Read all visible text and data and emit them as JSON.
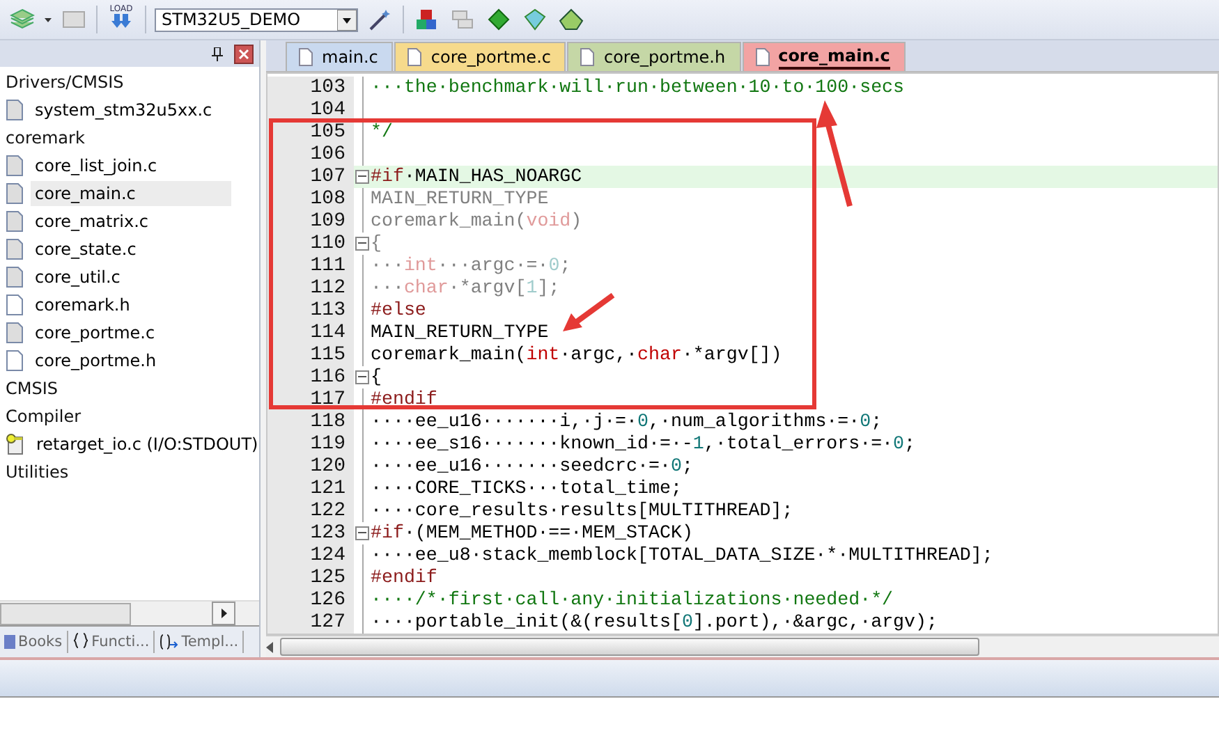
{
  "toolbar": {
    "load_label": "LOAD",
    "target": "STM32U5_DEMO"
  },
  "project_panel": {
    "tree": [
      {
        "label": "Drivers/CMSIS",
        "kind": "group",
        "children": [
          {
            "label": "system_stm32u5xx.c",
            "kind": "source",
            "selected": false
          }
        ]
      },
      {
        "label": "coremark",
        "kind": "group",
        "children": [
          {
            "label": "core_list_join.c",
            "kind": "source",
            "selected": false
          },
          {
            "label": "core_main.c",
            "kind": "source",
            "selected": true
          },
          {
            "label": "core_matrix.c",
            "kind": "source",
            "selected": false
          },
          {
            "label": "core_state.c",
            "kind": "source",
            "selected": false
          },
          {
            "label": "core_util.c",
            "kind": "source",
            "selected": false
          },
          {
            "label": "coremark.h",
            "kind": "header",
            "selected": false
          },
          {
            "label": "core_portme.c",
            "kind": "source",
            "selected": false
          },
          {
            "label": "core_portme.h",
            "kind": "header",
            "selected": false
          }
        ]
      },
      {
        "label": "CMSIS",
        "kind": "group"
      },
      {
        "label": "Compiler",
        "kind": "group",
        "children": [
          {
            "label": "retarget_io.c (I/O:STDOUT)",
            "kind": "config",
            "selected": false
          }
        ]
      },
      {
        "label": "Utilities",
        "kind": "group"
      }
    ],
    "bottom_tabs": [
      {
        "label": "Books",
        "kind": "books"
      },
      {
        "label": "Functi...",
        "kind": "functions"
      },
      {
        "label": "Templ...",
        "kind": "templates"
      }
    ]
  },
  "editor": {
    "tabs": [
      {
        "label": "main.c",
        "color": "#c9d9ef",
        "selected": false
      },
      {
        "label": "core_portme.c",
        "color": "#f6da8c",
        "selected": false
      },
      {
        "label": "core_portme.h",
        "color": "#c5d7a6",
        "selected": false
      },
      {
        "label": "core_main.c",
        "color": "#f2a3a3",
        "selected": true
      }
    ],
    "lines": [
      {
        "number": "103",
        "fold": false,
        "highlighted": false,
        "tokens": [
          {
            "text": "···the·benchmark·will·run·between·10·to·100·secs",
            "kind": "comment"
          }
        ]
      },
      {
        "number": "104",
        "fold": false,
        "highlighted": false
      },
      {
        "number": "105",
        "fold": false,
        "highlighted": false,
        "tokens": [
          {
            "text": "*/",
            "kind": "comment"
          }
        ]
      },
      {
        "number": "106",
        "fold": false,
        "highlighted": false
      },
      {
        "number": "107",
        "fold": true,
        "highlighted": true,
        "tokens": [
          {
            "text": "#if",
            "kind": "preproc"
          },
          {
            "text": "·MAIN_HAS_NOARGC",
            "kind": "plain"
          }
        ]
      },
      {
        "number": "108",
        "fold": false,
        "highlighted": false,
        "tokens": [
          {
            "text": "MAIN_RETURN_TYPE",
            "kind": "inactive"
          }
        ]
      },
      {
        "number": "109",
        "fold": false,
        "highlighted": false,
        "tokens": [
          {
            "text": "coremark_main(",
            "kind": "inactive"
          },
          {
            "text": "void",
            "kind": "inactive_keyword"
          },
          {
            "text": ")",
            "kind": "inactive"
          }
        ]
      },
      {
        "number": "110",
        "fold": true,
        "highlighted": false,
        "tokens": [
          {
            "text": "{",
            "kind": "inactive"
          }
        ]
      },
      {
        "number": "111",
        "fold": false,
        "highlighted": false,
        "tokens": [
          {
            "text": "···",
            "kind": "inactive"
          },
          {
            "text": "int",
            "kind": "inactive_keyword"
          },
          {
            "text": "···argc·=·",
            "kind": "inactive"
          },
          {
            "text": "0",
            "kind": "inactive_number"
          },
          {
            "text": ";",
            "kind": "inactive"
          }
        ]
      },
      {
        "number": "112",
        "fold": false,
        "highlighted": false,
        "tokens": [
          {
            "text": "···",
            "kind": "inactive"
          },
          {
            "text": "char",
            "kind": "inactive_keyword"
          },
          {
            "text": "·*argv[",
            "kind": "inactive"
          },
          {
            "text": "1",
            "kind": "inactive_number"
          },
          {
            "text": "];",
            "kind": "inactive"
          }
        ]
      },
      {
        "number": "113",
        "fold": false,
        "highlighted": false,
        "tokens": [
          {
            "text": "#else",
            "kind": "preproc"
          }
        ]
      },
      {
        "number": "114",
        "fold": false,
        "highlighted": false,
        "tokens": [
          {
            "text": "MAIN_RETURN_TYPE",
            "kind": "plain"
          }
        ]
      },
      {
        "number": "115",
        "fold": false,
        "highlighted": false,
        "tokens": [
          {
            "text": "coremark_main(",
            "kind": "plain"
          },
          {
            "text": "int",
            "kind": "keyword"
          },
          {
            "text": "·argc,·",
            "kind": "plain"
          },
          {
            "text": "char",
            "kind": "keyword"
          },
          {
            "text": "·*argv[])",
            "kind": "plain"
          }
        ]
      },
      {
        "number": "116",
        "fold": true,
        "highlighted": false,
        "tokens": [
          {
            "text": "{",
            "kind": "plain"
          }
        ]
      },
      {
        "number": "117",
        "fold": false,
        "highlighted": false,
        "tokens": [
          {
            "text": "#endif",
            "kind": "preproc"
          }
        ]
      },
      {
        "number": "118",
        "fold": false,
        "highlighted": false,
        "tokens": [
          {
            "text": "····ee_u16·······i,·j·=·",
            "kind": "plain"
          },
          {
            "text": "0",
            "kind": "number"
          },
          {
            "text": ",·num_algorithms·=·",
            "kind": "plain"
          },
          {
            "text": "0",
            "kind": "number"
          },
          {
            "text": ";",
            "kind": "plain"
          }
        ]
      },
      {
        "number": "119",
        "fold": false,
        "highlighted": false,
        "tokens": [
          {
            "text": "····ee_s16·······known_id·=·-",
            "kind": "plain"
          },
          {
            "text": "1",
            "kind": "number"
          },
          {
            "text": ",·total_errors·=·",
            "kind": "plain"
          },
          {
            "text": "0",
            "kind": "number"
          },
          {
            "text": ";",
            "kind": "plain"
          }
        ]
      },
      {
        "number": "120",
        "fold": false,
        "highlighted": false,
        "tokens": [
          {
            "text": "····ee_u16·······seedcrc·=·",
            "kind": "plain"
          },
          {
            "text": "0",
            "kind": "number"
          },
          {
            "text": ";",
            "kind": "plain"
          }
        ]
      },
      {
        "number": "121",
        "fold": false,
        "highlighted": false,
        "tokens": [
          {
            "text": "····CORE_TICKS···total_time;",
            "kind": "plain"
          }
        ]
      },
      {
        "number": "122",
        "fold": false,
        "highlighted": false,
        "tokens": [
          {
            "text": "····core_results·results[MULTITHREAD];",
            "kind": "plain"
          }
        ]
      },
      {
        "number": "123",
        "fold": true,
        "highlighted": false,
        "tokens": [
          {
            "text": "#if",
            "kind": "preproc"
          },
          {
            "text": "·(MEM_METHOD·==·MEM_STACK)",
            "kind": "plain"
          }
        ]
      },
      {
        "number": "124",
        "fold": false,
        "highlighted": false,
        "tokens": [
          {
            "text": "····ee_u8·stack_memblock[TOTAL_DATA_SIZE·*·MULTITHREAD];",
            "kind": "plain"
          }
        ]
      },
      {
        "number": "125",
        "fold": false,
        "highlighted": false,
        "tokens": [
          {
            "text": "#endif",
            "kind": "preproc"
          }
        ]
      },
      {
        "number": "126",
        "fold": false,
        "highlighted": false,
        "tokens": [
          {
            "text": "····/*·first·call·any·initializations·needed·*/",
            "kind": "comment"
          }
        ]
      },
      {
        "number": "127",
        "fold": false,
        "highlighted": false,
        "tokens": [
          {
            "text": "····portable_init(&(results[",
            "kind": "plain"
          },
          {
            "text": "0",
            "kind": "number"
          },
          {
            "text": "].port),·&argc,·argv);",
            "kind": "plain"
          }
        ]
      }
    ]
  }
}
